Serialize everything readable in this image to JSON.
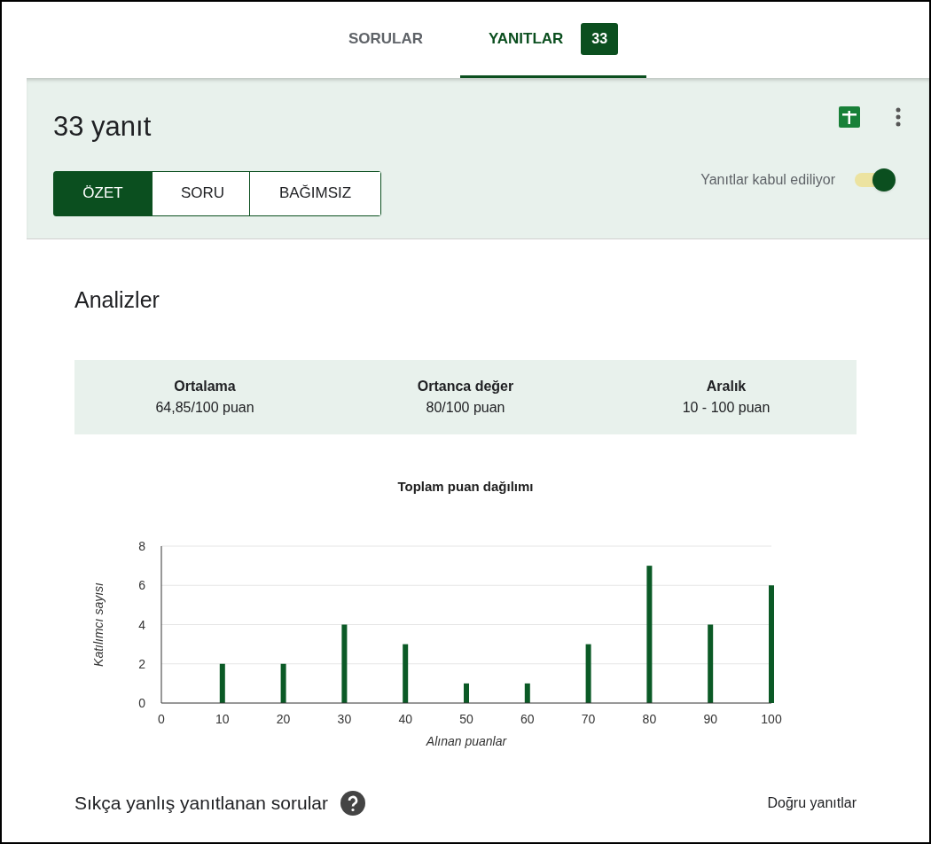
{
  "tabs": [
    {
      "label": "SORULAR",
      "selected": false
    },
    {
      "label": "YANITLAR",
      "selected": true,
      "badge": "33"
    }
  ],
  "summary": {
    "title": "33 yanıt",
    "views": [
      {
        "label": "ÖZET",
        "selected": true
      },
      {
        "label": "SORU",
        "selected": false
      },
      {
        "label": "BAĞIMSIZ",
        "selected": false
      }
    ],
    "accepting": {
      "label": "Yanıtlar kabul ediliyor",
      "on": true
    }
  },
  "analytics": {
    "title": "Analizler",
    "stats": [
      {
        "label": "Ortalama",
        "value": "64,85/100 puan"
      },
      {
        "label": "Ortanca değer",
        "value": "80/100 puan"
      },
      {
        "label": "Aralık",
        "value": "10 - 100 puan"
      }
    ],
    "chart_data": {
      "type": "bar",
      "title": "Toplam puan dağılımı",
      "xlabel": "Alınan puanlar",
      "ylabel": "Katılımcı sayısı",
      "x": [
        10,
        20,
        30,
        40,
        50,
        60,
        70,
        80,
        90,
        100
      ],
      "grid": true,
      "series": [
        {
          "color": "#0b5a26",
          "values": [
            2,
            2,
            4,
            3,
            1,
            1,
            3,
            7,
            4,
            6
          ]
        }
      ],
      "xlim": [
        0,
        100
      ],
      "ylim": [
        0,
        8
      ],
      "xticks": [
        0,
        10,
        20,
        30,
        40,
        50,
        60,
        70,
        80,
        90,
        100
      ],
      "yticks": [
        0,
        2,
        4,
        6,
        8
      ]
    }
  },
  "frequently_missed": {
    "title": "Sıkça yanlış yanıtlanan sorular",
    "link": "Doğru yanıtlar"
  }
}
